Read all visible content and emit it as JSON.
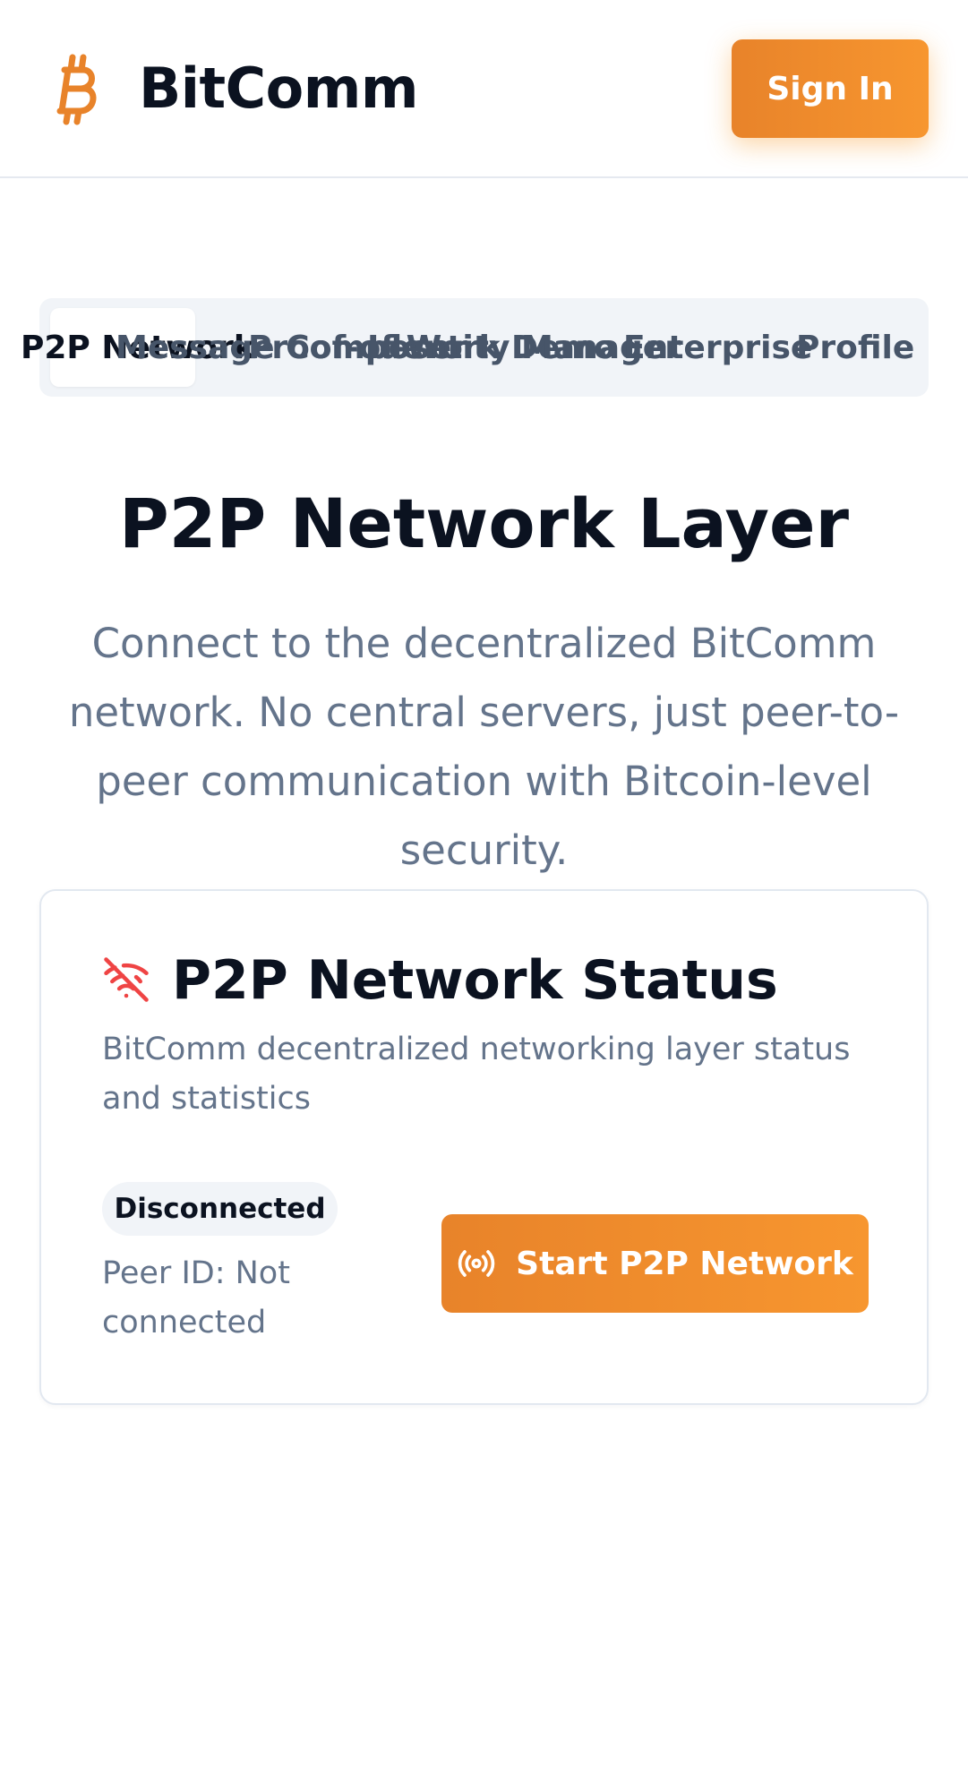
{
  "header": {
    "brand": "BitComm",
    "signin_label": "Sign In",
    "logo_icon": "bitcoin-icon",
    "accent_color": "#f7931a"
  },
  "tabs": [
    {
      "label": "P2P Network",
      "active": true
    },
    {
      "label": "Message Composer",
      "active": false
    },
    {
      "label": "Proof-of-Work Demo",
      "active": false
    },
    {
      "label": "Identity Manager",
      "active": false
    },
    {
      "label": "Enterprise",
      "active": false
    },
    {
      "label": "Profile",
      "active": false
    }
  ],
  "main": {
    "title": "P2P Network Layer",
    "description": "Connect to the decentralized BitComm network. No central servers, just peer-to-peer communication with Bitcoin-level security."
  },
  "status_card": {
    "icon": "wifi-off-icon",
    "icon_color": "#ef4444",
    "title": "P2P Network Status",
    "description": "BitComm decentralized networking layer status and statistics",
    "badge": "Disconnected",
    "peer_id": "Peer ID: Not connected",
    "start_label": "Start P2P Network",
    "start_icon": "radio-icon"
  }
}
